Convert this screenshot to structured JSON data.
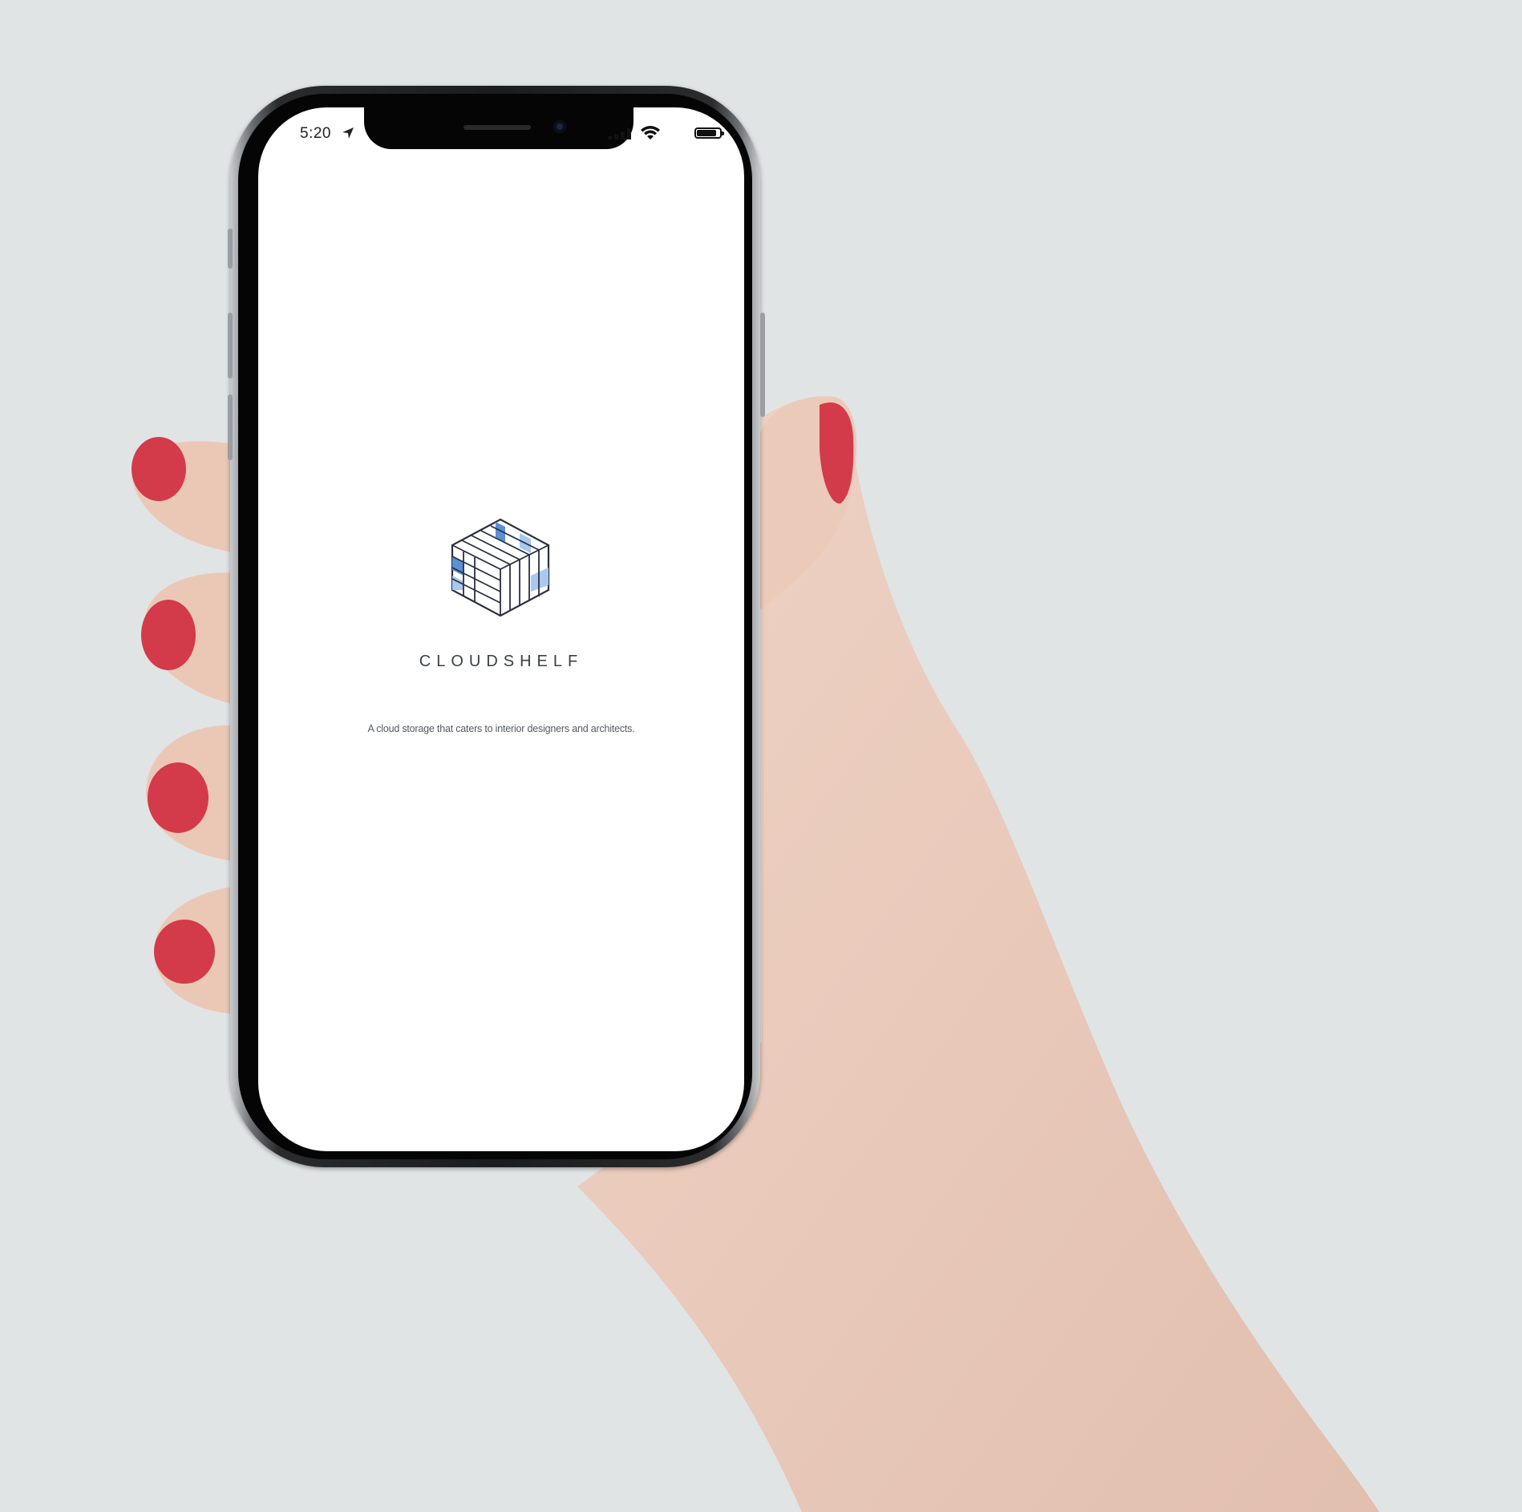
{
  "app": {
    "brand_name": "CLOUDSHELF",
    "tagline": "A cloud storage that caters to interior designers and architects."
  },
  "status_bar": {
    "time": "5:20",
    "battery_level": 0.85,
    "icons": [
      "location-arrow-icon",
      "cellular-signal-icon",
      "wifi-icon",
      "battery-icon"
    ]
  },
  "colors": {
    "background": "#e1e4e5",
    "screen": "#ffffff",
    "logo_stroke": "#2b3040",
    "logo_blue": "#5b8fd6",
    "logo_light_blue": "#a9c8ef",
    "nail_red": "#d33a4a"
  }
}
